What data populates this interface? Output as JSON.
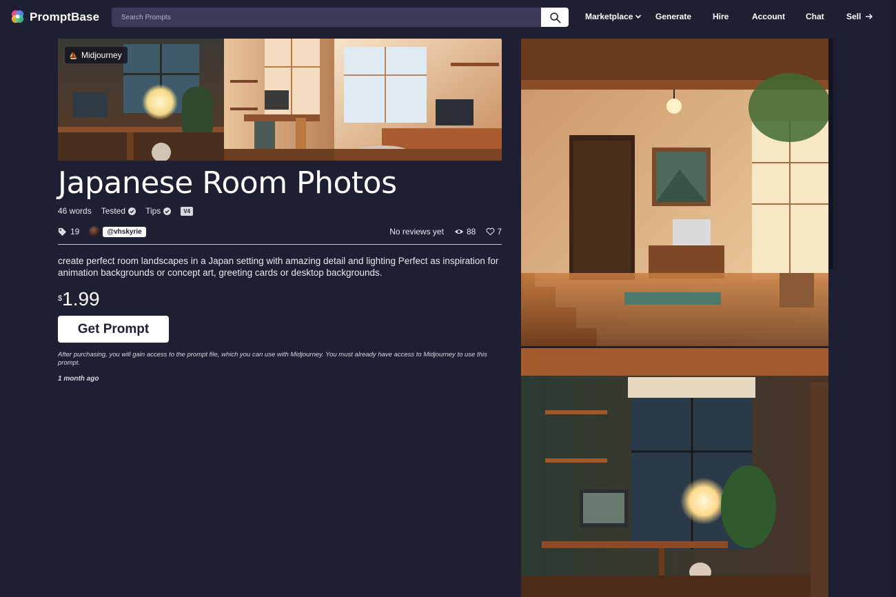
{
  "nav": {
    "brand": "PromptBase",
    "search_placeholder": "Search Prompts",
    "links": {
      "marketplace": "Marketplace",
      "generate": "Generate",
      "hire": "Hire",
      "account": "Account",
      "chat": "Chat",
      "sell": "Sell"
    }
  },
  "prompt": {
    "model": "Midjourney",
    "title": "Japanese Room Photos",
    "words": "46 words",
    "tested": "Tested",
    "tips": "Tips",
    "version": "V4",
    "tag_count": "19",
    "author": "@vhskyrie",
    "reviews": "No reviews yet",
    "views": "88",
    "likes": "7",
    "description": "create perfect room landscapes in a Japan  setting with amazing detail and lighting Perfect as inspiration for animation backgrounds or concept art, greeting cards or desktop backgrounds.",
    "currency": "$",
    "price": "1.99",
    "cta": "Get Prompt",
    "disclaimer": "After purchasing, you will gain access to the prompt file, which you can use with Midjourney. You must already have access to Midjourney to use this prompt.",
    "posted": "1 month ago"
  },
  "icons": {
    "logo": "promptbase-logo-icon",
    "search": "search-icon",
    "chevron": "chevron-down-icon",
    "arrow": "arrow-right-icon",
    "tag": "tag-icon",
    "eye": "eye-icon",
    "heart": "heart-icon",
    "check": "verified-check-icon",
    "sailboat": "midjourney-sailboat-icon"
  },
  "colors": {
    "background": "#1f1f33",
    "search_bg": "#3a3a5b",
    "text": "#ffffff",
    "button_bg": "#ffffff",
    "button_text": "#1f1f33"
  }
}
